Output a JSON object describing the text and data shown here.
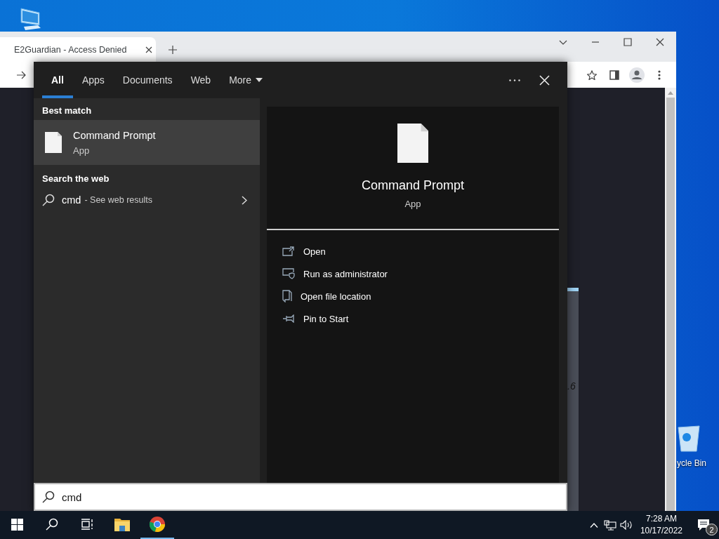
{
  "desktop": {
    "icons": [
      {
        "kind": "computer"
      },
      {
        "kind": "recycle-bin",
        "label": "ycle Bin"
      }
    ]
  },
  "browser": {
    "tabs": [
      {
        "title": "E2Guardian - Access Denied",
        "selected": true
      }
    ],
    "page_fragment": ".6"
  },
  "search": {
    "tabs": [
      {
        "label": "All",
        "selected": true,
        "kind": "plain"
      },
      {
        "label": "Apps",
        "selected": false,
        "kind": "plain"
      },
      {
        "label": "Documents",
        "selected": false,
        "kind": "plain"
      },
      {
        "label": "Web",
        "selected": false,
        "kind": "plain"
      },
      {
        "label": "More",
        "selected": false,
        "kind": "dropdown"
      }
    ],
    "best_match_heading": "Best match",
    "best_match": {
      "name": "Command Prompt",
      "type": "App",
      "selected": true
    },
    "web_heading": "Search the web",
    "web_result": {
      "query": "cmd",
      "suffix": "- See web results"
    },
    "preview": {
      "name": "Command Prompt",
      "type": "App"
    },
    "actions": [
      {
        "kind": "open",
        "label": "Open"
      },
      {
        "kind": "admin",
        "label": "Run as administrator"
      },
      {
        "kind": "folder",
        "label": "Open file location"
      },
      {
        "kind": "pin",
        "label": "Pin to Start"
      }
    ],
    "query": "cmd"
  },
  "taskbar": {
    "apps": [
      {
        "kind": "start",
        "active": false
      },
      {
        "kind": "search",
        "active": false
      },
      {
        "kind": "taskview",
        "active": false
      },
      {
        "kind": "explorer",
        "active": false
      },
      {
        "kind": "chrome",
        "active": true
      }
    ],
    "time": "7:28 AM",
    "date": "10/17/2022",
    "notifications": "2"
  }
}
